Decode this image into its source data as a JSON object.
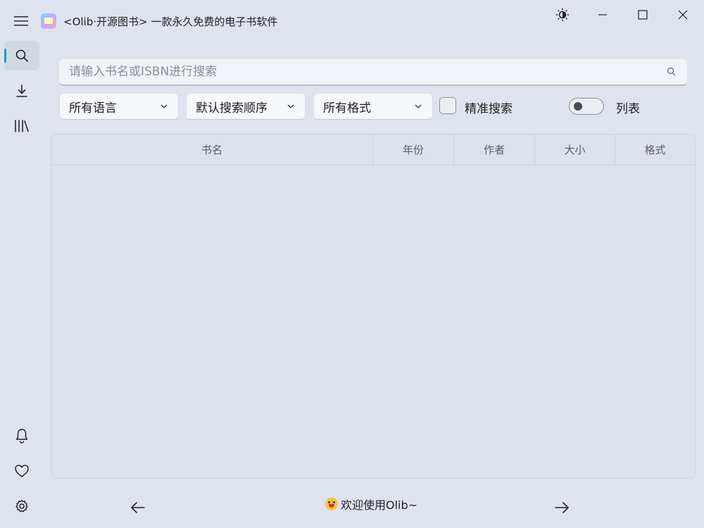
{
  "window": {
    "title": "<Olib·开源图书> 一款永久免费的电子书软件"
  },
  "titlebar_icons": {
    "menu": "hamburger-icon",
    "theme": "brightness-icon",
    "minimize": "minimize-icon",
    "maximize": "maximize-icon",
    "close": "close-icon"
  },
  "sidebar": {
    "items": [
      {
        "name": "search",
        "icon": "search-icon",
        "active": true
      },
      {
        "name": "download",
        "icon": "download-icon",
        "active": false
      },
      {
        "name": "library",
        "icon": "library-icon",
        "active": false
      }
    ],
    "bottom_items": [
      {
        "name": "notifications",
        "icon": "bell-icon"
      },
      {
        "name": "favorites",
        "icon": "heart-icon"
      },
      {
        "name": "settings",
        "icon": "gear-icon"
      }
    ],
    "accent_color": "#1a9eaa"
  },
  "search": {
    "placeholder": "请输入书名或ISBN进行搜索",
    "value": ""
  },
  "filters": {
    "language": "所有语言",
    "order": "默认搜索顺序",
    "format": "所有格式",
    "exact_search_label": "精准搜索",
    "exact_search_checked": false,
    "list_view_label": "列表",
    "list_view_on": false
  },
  "table": {
    "columns": [
      "书名",
      "年份",
      "作者",
      "大小",
      "格式"
    ],
    "rows": []
  },
  "footer": {
    "welcome": "欢迎使用Olib~"
  }
}
